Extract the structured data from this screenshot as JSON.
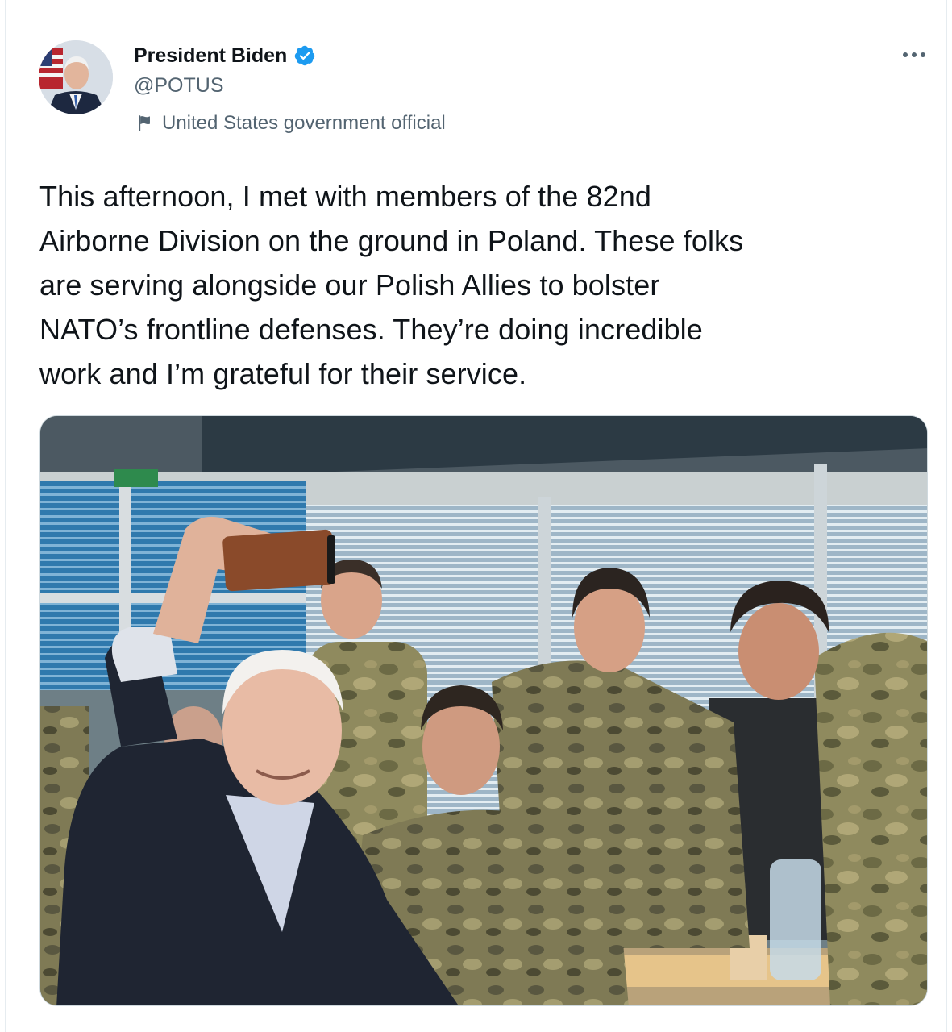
{
  "author": {
    "display_name": "President Biden",
    "handle": "@POTUS",
    "affiliation": "United States government official",
    "verified": true,
    "avatar_icon": "profile-photo",
    "verified_icon": "verified-badge-icon",
    "flag_icon": "flag-icon"
  },
  "more_icon": "more-options-icon",
  "tweet": {
    "text": "This afternoon, I met with members of the 82nd\nAirborne Division on the ground in Poland. These folks\nare serving alongside our Polish Allies to bolster\nNATO’s frontline defenses. They’re doing incredible\nwork and I’m grateful for their service."
  },
  "media": {
    "type": "photo"
  },
  "colors": {
    "verified_blue": "#1d9bf0",
    "secondary_text": "#536471",
    "primary_text": "#0f1419"
  }
}
